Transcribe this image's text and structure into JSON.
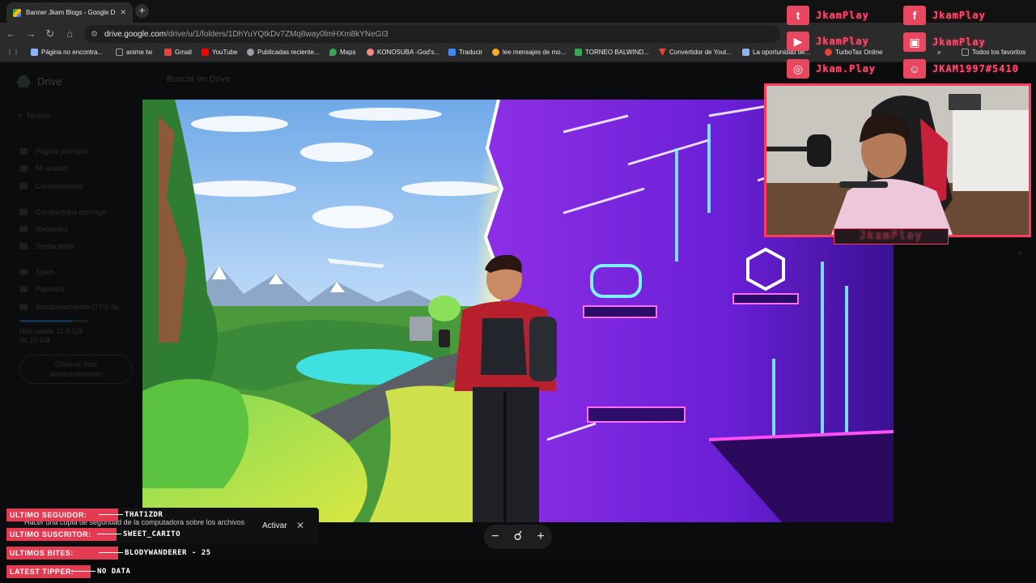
{
  "browser": {
    "tab_title": "Banner Jkam Blogs - Google Dr",
    "url_host": "drive.google.com",
    "url_path": "/drive/u/1/folders/1DhYuYQtkDv7ZMq8way0lmHXm8kYNeGI3",
    "bookmarks": [
      {
        "label": "Página no encontra...",
        "color": "#8ab4f8"
      },
      {
        "label": "anime tw",
        "color": "#9aa0a6"
      },
      {
        "label": "Gmail",
        "color": "#ea4335"
      },
      {
        "label": "YouTube",
        "color": "#ff0000"
      },
      {
        "label": "Publicadas reciente...",
        "color": "#9aa0a6"
      },
      {
        "label": "Maps",
        "color": "#34a853"
      },
      {
        "label": "KONOSUBA -God's...",
        "color": "#f28b82"
      },
      {
        "label": "Traducir",
        "color": "#4285f4"
      },
      {
        "label": "lee mensajes de mo...",
        "color": "#f6ae2d"
      },
      {
        "label": "TORNEO BALWIND...",
        "color": "#34a853"
      },
      {
        "label": "Convertidor de Yout...",
        "color": "#ea4335"
      },
      {
        "label": "La oportunidad de...",
        "color": "#8ab4f8"
      },
      {
        "label": "TurboTax Online",
        "color": "#ea4335"
      }
    ],
    "bookmarks_overflow": "»",
    "all_bookmarks": "Todos los favoritos"
  },
  "drive": {
    "logo_text": "Drive",
    "search_placeholder": "Buscar en Drive",
    "new_button": "Nuevo",
    "sidebar": [
      {
        "label": "Página principal"
      },
      {
        "label": "Mi unidad"
      },
      {
        "label": "Computadoras"
      },
      {
        "label": "Compartidos conmigo"
      },
      {
        "label": "Recientes"
      },
      {
        "label": "Destacados"
      },
      {
        "label": "Spam"
      },
      {
        "label": "Papelera"
      },
      {
        "label": "Almacenamiento (77% lle..."
      }
    ],
    "storage_text": "Has usado 11.6 GB de 15 GB",
    "storage_fraction": 0.77,
    "buy_button": "Obtener más almacenamiento"
  },
  "viewer": {
    "zoom_out": "−",
    "zoom_icon": "magnifier",
    "zoom_in": "+"
  },
  "toast": {
    "message": "Hacer una copia de seguridad de la computadora sobre los archivos",
    "action": "Activar",
    "close": "✕"
  },
  "overlay": {
    "socials": [
      {
        "network": "twitter",
        "handle": "JkamPlay"
      },
      {
        "network": "facebook",
        "handle": "JkamPlay"
      },
      {
        "network": "youtube",
        "handle": "JkamPlay"
      },
      {
        "network": "twitch",
        "handle": "JkamPlay"
      },
      {
        "network": "instagram",
        "handle": "Jkam.Play"
      },
      {
        "network": "discord",
        "handle": "JKAM1997#5410"
      }
    ],
    "cam_name": "JkamPlay",
    "stats": [
      {
        "label": "ULTIMO SEGUIDOR:",
        "value": "THAT1ZDR"
      },
      {
        "label": "ULTIMO SUSCRITOR:",
        "value": "SWEET_CARITO"
      },
      {
        "label": "ULTIMOS BITES:",
        "value": "BLODYWANDERER - 25"
      },
      {
        "label": "LATEST TIPPER:",
        "value": "NO DATA"
      }
    ],
    "accent_color": "#e23b52"
  }
}
